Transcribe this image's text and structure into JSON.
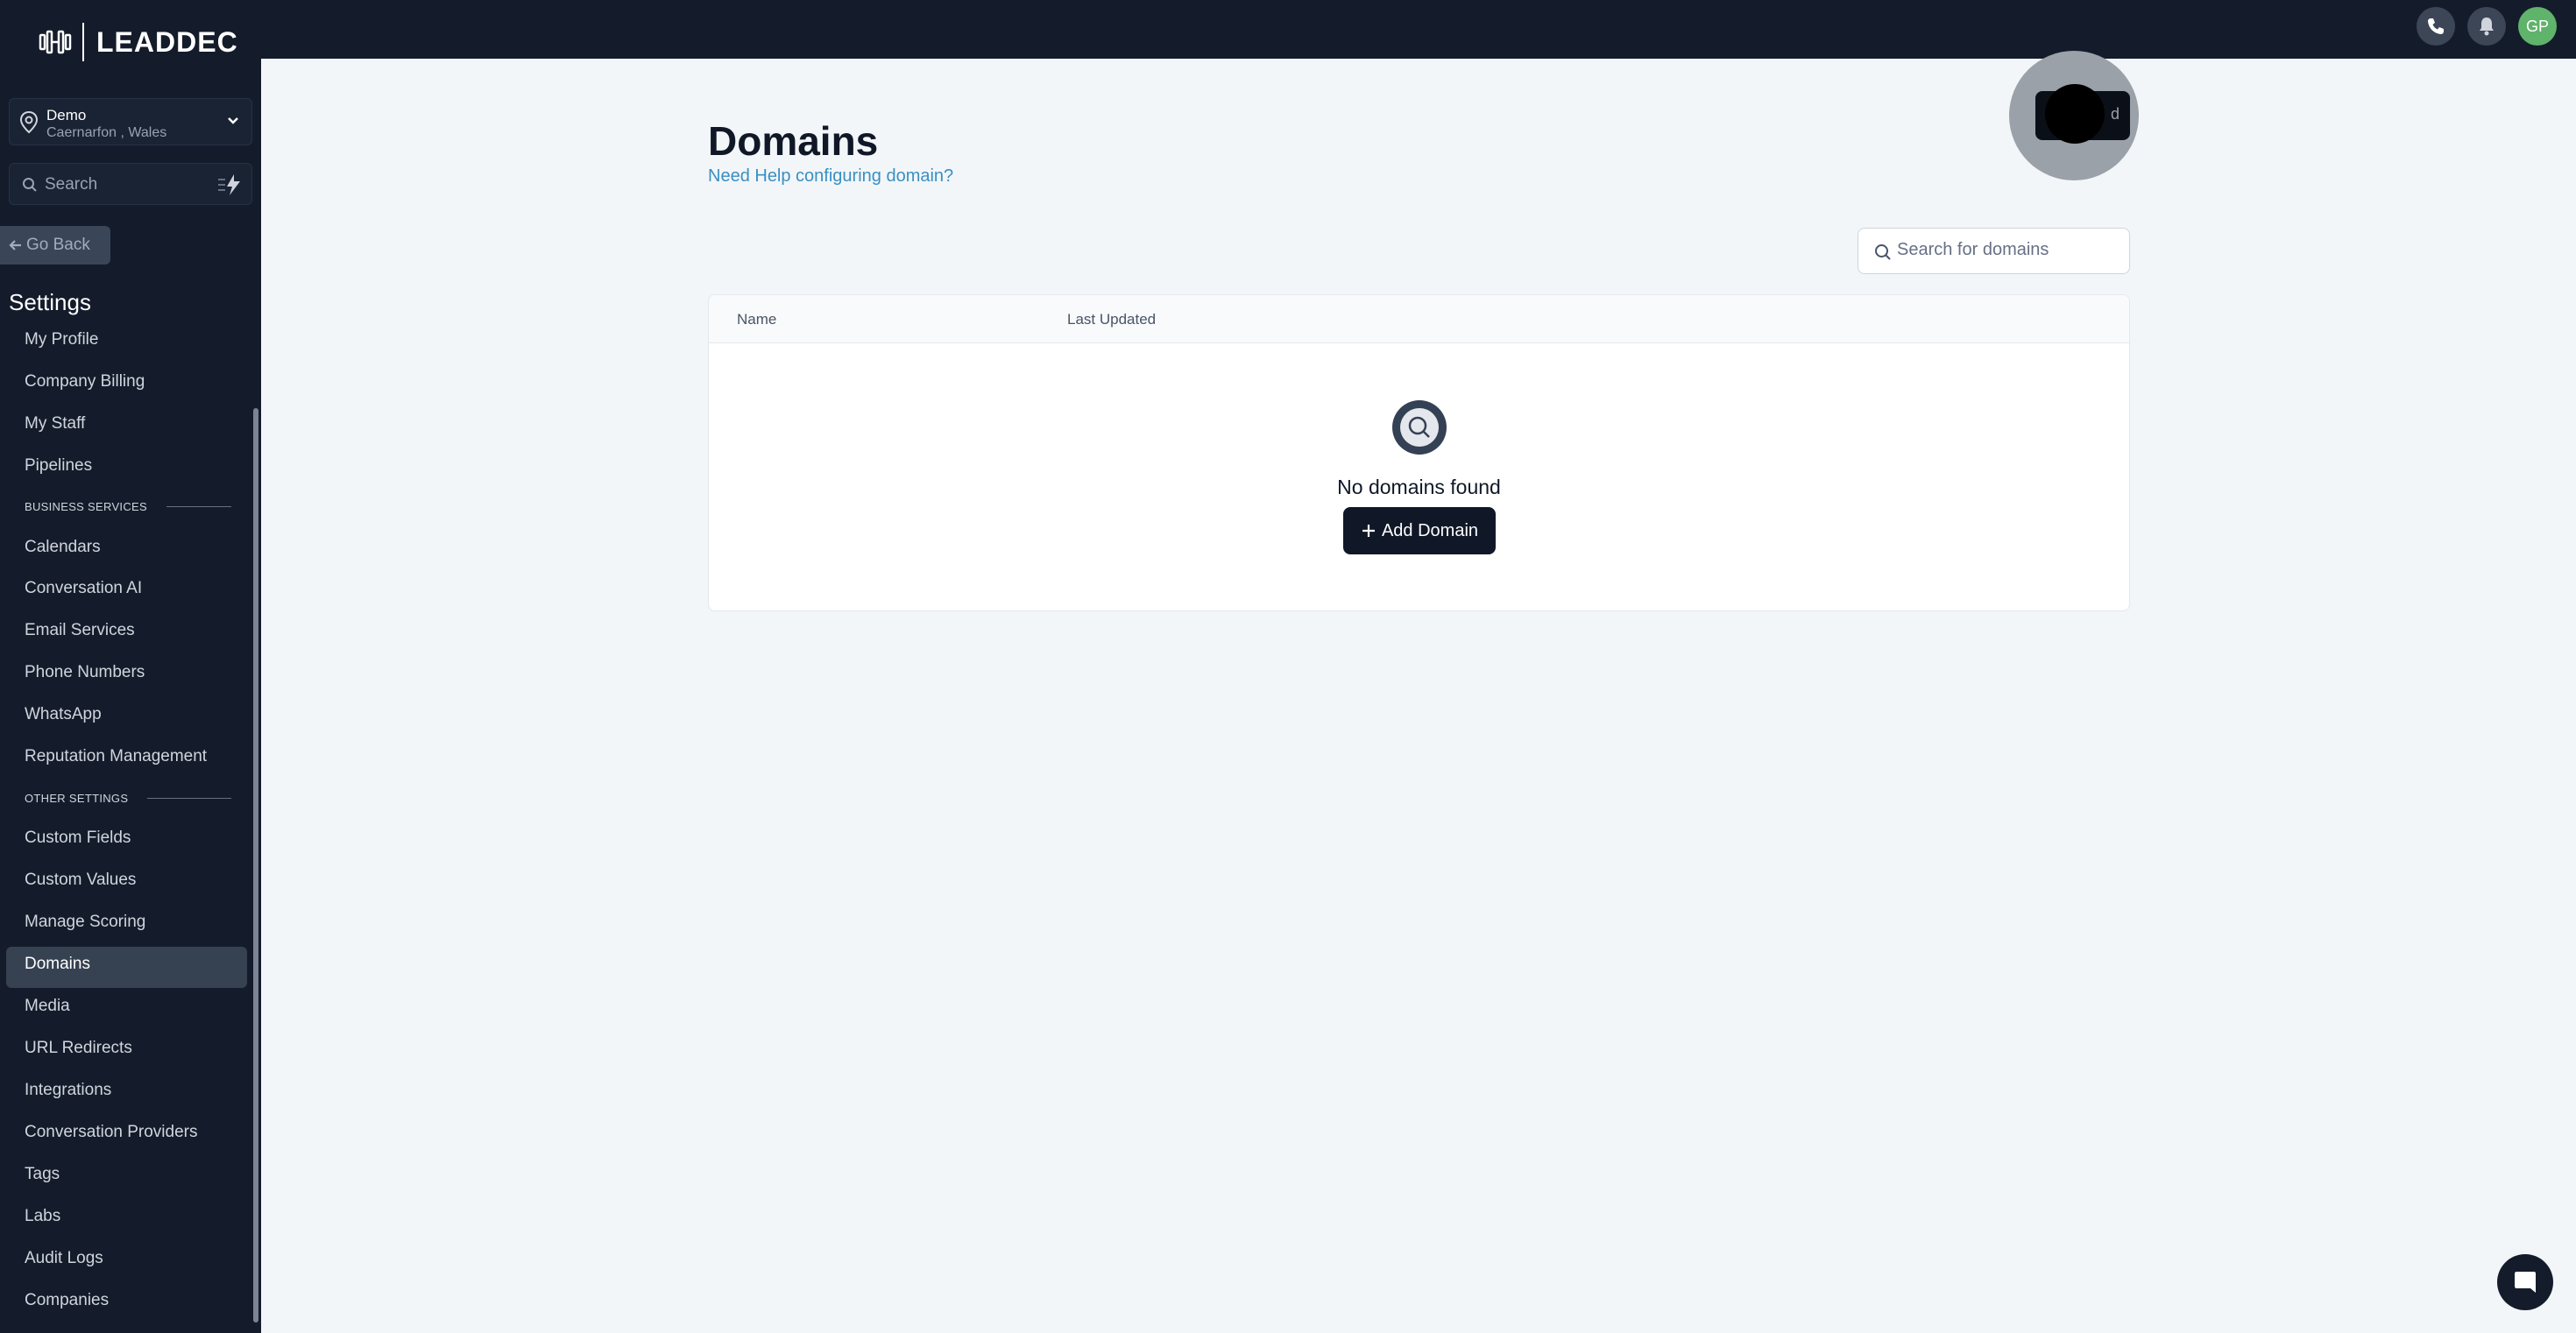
{
  "brand": {
    "name": "LEADDEC"
  },
  "location": {
    "name": "Demo",
    "address": "Caernarfon , Wales"
  },
  "sidebar_search": {
    "placeholder": "Search"
  },
  "go_back": {
    "label": "Go Back"
  },
  "settings": {
    "title": "Settings",
    "items_top": [
      "My Profile",
      "Company Billing",
      "My Staff",
      "Pipelines"
    ],
    "section_business": "BUSINESS SERVICES",
    "items_business": [
      "Calendars",
      "Conversation AI",
      "Email Services",
      "Phone Numbers",
      "WhatsApp",
      "Reputation Management"
    ],
    "section_other": "OTHER SETTINGS",
    "items_other": [
      "Custom Fields",
      "Custom Values",
      "Manage Scoring",
      "Domains",
      "Media",
      "URL Redirects",
      "Integrations",
      "Conversation Providers",
      "Tags",
      "Labs",
      "Audit Logs",
      "Companies"
    ],
    "active": "Domains"
  },
  "topbar": {
    "avatar_initials": "GP"
  },
  "main": {
    "title": "Domains",
    "help_link": "Need Help configuring domain?",
    "video_button_label": "d",
    "search_placeholder": "Search for domains",
    "table": {
      "columns": [
        "Name",
        "Last Updated"
      ],
      "empty_text": "No domains found",
      "add_button": "Add Domain"
    }
  },
  "colors": {
    "sidebar": "#141c2b",
    "accent": "#3a8fc2",
    "avatar": "#5fb36a"
  }
}
